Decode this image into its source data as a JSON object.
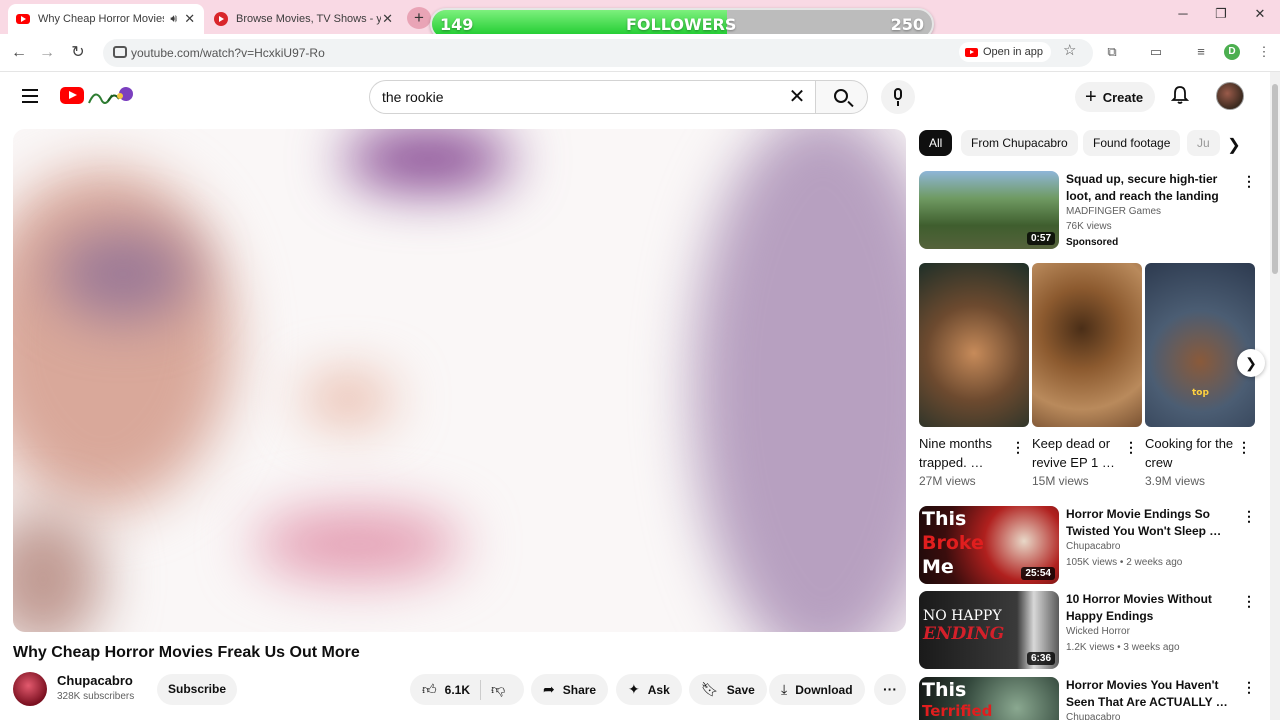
{
  "browser": {
    "tabs": [
      {
        "title": "Why Cheap Horror Movies F",
        "active": true
      },
      {
        "title": "Browse Movies, TV Shows - yFli",
        "active": false
      }
    ],
    "url": "youtube.com/watch?v=HcxkiU97-Ro",
    "open_in_app": "Open in app",
    "profile_initial": "D"
  },
  "followers_bar": {
    "current": "149",
    "label": "FOLLOWERS",
    "goal": "250",
    "progress": 0.59
  },
  "header": {
    "search_query": "the rookie",
    "create_label": "Create"
  },
  "video": {
    "title": "Why Cheap Horror Movies Freak Us Out More",
    "channel": "Chupacabro",
    "subscribers": "328K subscribers",
    "subscribe_label": "Subscribe",
    "likes": "6.1K",
    "actions": {
      "share": "Share",
      "ask": "Ask",
      "save": "Save",
      "download": "Download"
    }
  },
  "chips": [
    "All",
    "From Chupacabro",
    "Found footage",
    "Ju"
  ],
  "recommendations": [
    {
      "title": "Squad up, secure high-tier loot, and reach the landing zone…",
      "channel": "MADFINGER Games",
      "meta": "76K views",
      "duration": "0:57",
      "sponsored": "Sponsored"
    },
    {
      "title": "Horror Movie Endings So Twisted You Won't Sleep …",
      "channel": "Chupacabro",
      "meta": "105K views • 2 weeks ago",
      "duration": "25:54",
      "thumb_text": [
        "This",
        "Broke",
        "Me"
      ]
    },
    {
      "title": "10 Horror Movies Without Happy Endings",
      "channel": "Wicked Horror",
      "meta": "1.2K views • 3 weeks ago",
      "duration": "6:36",
      "thumb_text": [
        "NO HAPPY",
        "ENDING"
      ]
    },
    {
      "title": "Horror Movies You Haven't Seen That Are ACTUALLY …",
      "channel": "Chupacabro",
      "meta": "",
      "duration": "",
      "thumb_text": [
        "This",
        "Terrified"
      ]
    }
  ],
  "shorts": [
    {
      "title": "Nine months trapped. …",
      "views": "27M views"
    },
    {
      "title": "Keep dead or revive EP 1 …",
      "views": "15M views"
    },
    {
      "title": "Cooking for the crew",
      "views": "3.9M views",
      "thumb_caption": "top"
    }
  ],
  "colors": {
    "youtube_red": "#ff0000",
    "tabstrip_bg": "#f9d9e4",
    "progress_green": "#18c92a"
  }
}
